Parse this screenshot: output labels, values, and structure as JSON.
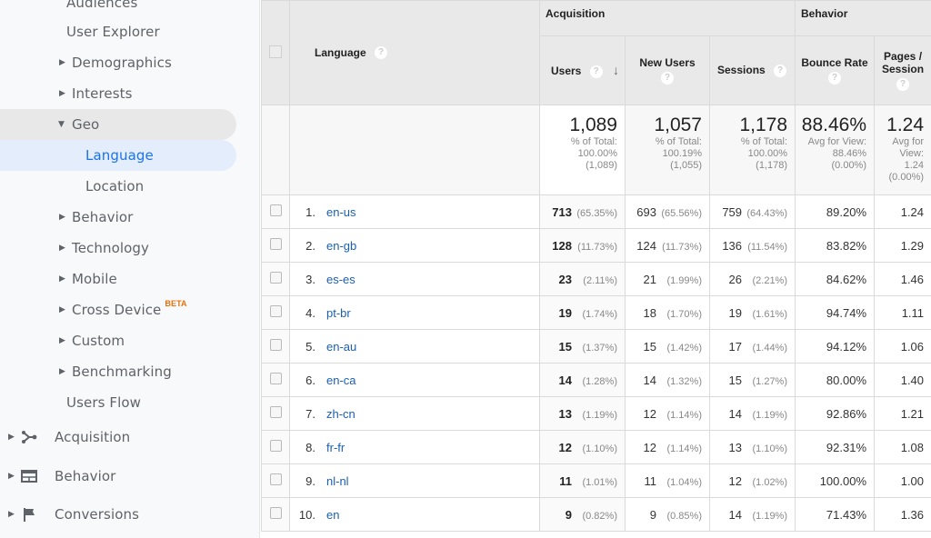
{
  "sidebar": {
    "items": [
      {
        "label": "Audiences"
      },
      {
        "label": "User Explorer"
      },
      {
        "label": "Demographics"
      },
      {
        "label": "Interests"
      },
      {
        "label": "Geo"
      },
      {
        "label": "Language"
      },
      {
        "label": "Location"
      },
      {
        "label": "Behavior"
      },
      {
        "label": "Technology"
      },
      {
        "label": "Mobile"
      },
      {
        "label": "Cross Device",
        "badge": "BETA"
      },
      {
        "label": "Custom"
      },
      {
        "label": "Benchmarking"
      },
      {
        "label": "Users Flow"
      }
    ],
    "sections": [
      {
        "label": "Acquisition",
        "icon": "acquisition-icon"
      },
      {
        "label": "Behavior",
        "icon": "behavior-icon"
      },
      {
        "label": "Conversions",
        "icon": "flag-icon"
      }
    ]
  },
  "table": {
    "dimension_header": "Language",
    "groups": {
      "acquisition": "Acquisition",
      "behavior": "Behavior"
    },
    "columns": {
      "users": "Users",
      "new_users": "New Users",
      "sessions": "Sessions",
      "bounce_rate": "Bounce Rate",
      "pages_session": "Pages / Session"
    },
    "help_glyph": "?",
    "sort_glyph": "↓",
    "totals": {
      "users": {
        "value": "1,089",
        "l1": "% of Total:",
        "l2": "100.00%",
        "l3": "(1,089)"
      },
      "new_users": {
        "value": "1,057",
        "l1": "% of Total:",
        "l2": "100.19%",
        "l3": "(1,055)"
      },
      "sessions": {
        "value": "1,178",
        "l1": "% of Total:",
        "l2": "100.00%",
        "l3": "(1,178)"
      },
      "bounce_rate": {
        "value": "88.46%",
        "l1": "Avg for View:",
        "l2": "88.46%",
        "l3": "(0.00%)"
      },
      "pages_session": {
        "value": "1.24",
        "l1": "Avg for",
        "l2": "View:",
        "l3": "1.24",
        "l4": "(0.00%)"
      }
    },
    "rows": [
      {
        "idx": "1.",
        "lang": "en-us",
        "users": "713",
        "users_pct": "(65.35%)",
        "new_users": "693",
        "new_users_pct": "(65.56%)",
        "sessions": "759",
        "sessions_pct": "(64.43%)",
        "bounce": "89.20%",
        "pps": "1.24"
      },
      {
        "idx": "2.",
        "lang": "en-gb",
        "users": "128",
        "users_pct": "(11.73%)",
        "new_users": "124",
        "new_users_pct": "(11.73%)",
        "sessions": "136",
        "sessions_pct": "(11.54%)",
        "bounce": "83.82%",
        "pps": "1.29"
      },
      {
        "idx": "3.",
        "lang": "es-es",
        "users": "23",
        "users_pct": "(2.11%)",
        "new_users": "21",
        "new_users_pct": "(1.99%)",
        "sessions": "26",
        "sessions_pct": "(2.21%)",
        "bounce": "84.62%",
        "pps": "1.46"
      },
      {
        "idx": "4.",
        "lang": "pt-br",
        "users": "19",
        "users_pct": "(1.74%)",
        "new_users": "18",
        "new_users_pct": "(1.70%)",
        "sessions": "19",
        "sessions_pct": "(1.61%)",
        "bounce": "94.74%",
        "pps": "1.11"
      },
      {
        "idx": "5.",
        "lang": "en-au",
        "users": "15",
        "users_pct": "(1.37%)",
        "new_users": "15",
        "new_users_pct": "(1.42%)",
        "sessions": "17",
        "sessions_pct": "(1.44%)",
        "bounce": "94.12%",
        "pps": "1.06"
      },
      {
        "idx": "6.",
        "lang": "en-ca",
        "users": "14",
        "users_pct": "(1.28%)",
        "new_users": "14",
        "new_users_pct": "(1.32%)",
        "sessions": "15",
        "sessions_pct": "(1.27%)",
        "bounce": "80.00%",
        "pps": "1.40"
      },
      {
        "idx": "7.",
        "lang": "zh-cn",
        "users": "13",
        "users_pct": "(1.19%)",
        "new_users": "12",
        "new_users_pct": "(1.14%)",
        "sessions": "14",
        "sessions_pct": "(1.19%)",
        "bounce": "92.86%",
        "pps": "1.21"
      },
      {
        "idx": "8.",
        "lang": "fr-fr",
        "users": "12",
        "users_pct": "(1.10%)",
        "new_users": "12",
        "new_users_pct": "(1.14%)",
        "sessions": "13",
        "sessions_pct": "(1.10%)",
        "bounce": "92.31%",
        "pps": "1.08"
      },
      {
        "idx": "9.",
        "lang": "nl-nl",
        "users": "11",
        "users_pct": "(1.01%)",
        "new_users": "11",
        "new_users_pct": "(1.04%)",
        "sessions": "12",
        "sessions_pct": "(1.02%)",
        "bounce": "100.00%",
        "pps": "1.00"
      },
      {
        "idx": "10.",
        "lang": "en",
        "users": "9",
        "users_pct": "(0.82%)",
        "new_users": "9",
        "new_users_pct": "(0.85%)",
        "sessions": "14",
        "sessions_pct": "(1.19%)",
        "bounce": "71.43%",
        "pps": "1.36"
      }
    ]
  }
}
